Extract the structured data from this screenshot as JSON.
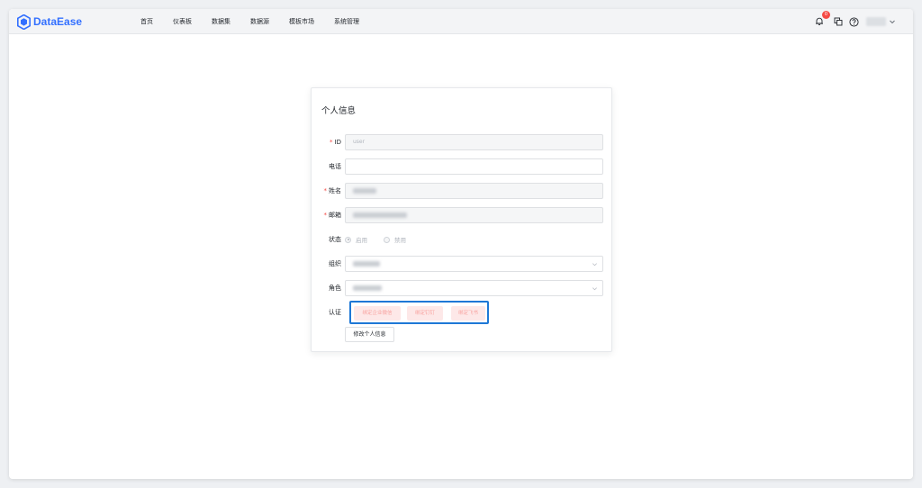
{
  "app": {
    "name": "DataEase",
    "brand_color": "#3370ff"
  },
  "nav": {
    "items": [
      {
        "label": "首页"
      },
      {
        "label": "仪表板"
      },
      {
        "label": "数据集"
      },
      {
        "label": "数据源"
      },
      {
        "label": "模板市场"
      },
      {
        "label": "系统管理"
      }
    ]
  },
  "toolbar": {
    "notification_count": "0",
    "icons": [
      "bell-icon",
      "copy-icon",
      "help-icon"
    ]
  },
  "profile": {
    "title": "个人信息",
    "fields": {
      "id": {
        "label": "ID",
        "required": true,
        "value": "user"
      },
      "phone": {
        "label": "电话",
        "required": false,
        "value": ""
      },
      "name": {
        "label": "姓名",
        "required": true
      },
      "email": {
        "label": "邮箱",
        "required": true
      },
      "status": {
        "label": "状态",
        "options": [
          {
            "label": "启用",
            "selected": true
          },
          {
            "label": "禁用",
            "selected": false
          }
        ]
      },
      "org": {
        "label": "组织"
      },
      "role": {
        "label": "角色"
      },
      "auth": {
        "label": "认证",
        "buttons": [
          {
            "label": "绑定企业微信"
          },
          {
            "label": "绑定钉钉"
          },
          {
            "label": "绑定飞书"
          }
        ]
      }
    },
    "submit_label": "修改个人信息"
  }
}
